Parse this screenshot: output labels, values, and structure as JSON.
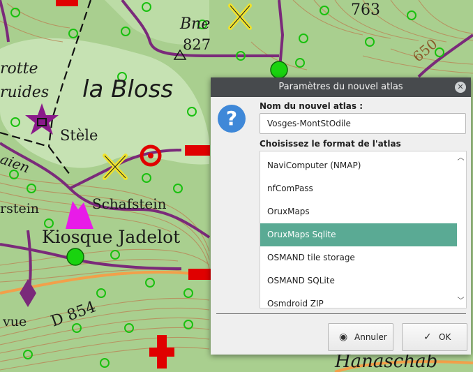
{
  "map": {
    "labels": {
      "bne": "Bne",
      "alt827": "827",
      "alt763": "763",
      "alt650": "650",
      "grotte": "rotte",
      "druides": "ruides",
      "bloss": "la Bloss",
      "stele": "Stèle",
      "paien": "aien",
      "stein": "rstein",
      "schafstein": "Schafstein",
      "kiosque": "Kiosque Jadelot",
      "vue": "vue",
      "road": "D 854",
      "hanaschab": "Hanaschab"
    },
    "colors": {
      "terrain": "#a9cf8f",
      "forest_light": "#c6e2b3",
      "contour": "#b98a5a",
      "trail": "#7a2a7a",
      "road": "#f2a04a",
      "marker_red": "#e00000",
      "marker_yellow": "#f1e32a",
      "marker_green": "#19d30f",
      "marker_magenta": "#e81be8",
      "star_purple": "#8a1a8a"
    }
  },
  "dialog": {
    "title": "Paramètres du nouvel atlas",
    "close_icon": "close-icon",
    "question_icon": "question-icon",
    "question_glyph": "?",
    "close_glyph": "✕",
    "name_label": "Nom du nouvel atlas :",
    "name_value": "Vosges-MontStOdile",
    "format_label": "Choisissez le format de l'atlas",
    "formats": [
      "NaviComputer (NMAP)",
      "nfComPass",
      "OruxMaps",
      "OruxMaps Sqlite",
      "OSMAND tile storage",
      "OSMAND SQLite",
      "Osmdroid ZIP"
    ],
    "selected_format": "OruxMaps Sqlite",
    "scroll_up_glyph": "︿",
    "scroll_down_glyph": "﹀",
    "cancel_label": "Annuler",
    "ok_label": "OK",
    "cancel_glyph": "◉",
    "ok_glyph": "✓",
    "colors": {
      "titlebar": "#474a4d",
      "selection": "#5aaa94",
      "question": "#3f88d8"
    }
  }
}
